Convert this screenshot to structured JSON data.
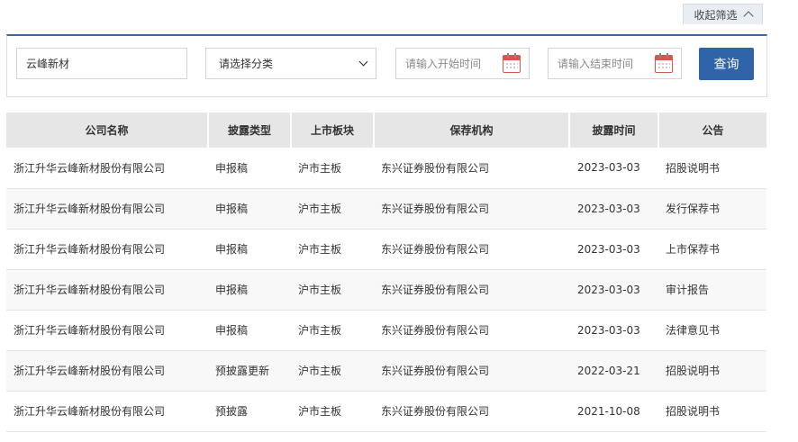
{
  "filter": {
    "collapse_label": "收起筛选",
    "company_value": "云峰新材",
    "category_placeholder": "请选择分类",
    "start_placeholder": "请输入开始时间",
    "end_placeholder": "请输入结束时间",
    "search_label": "查询"
  },
  "table": {
    "headers": [
      "公司名称",
      "披露类型",
      "上市板块",
      "保荐机构",
      "披露时间",
      "公告"
    ],
    "rows": [
      [
        "浙江升华云峰新材股份有限公司",
        "申报稿",
        "沪市主板",
        "东兴证券股份有限公司",
        "2023-03-03",
        "招股说明书"
      ],
      [
        "浙江升华云峰新材股份有限公司",
        "申报稿",
        "沪市主板",
        "东兴证券股份有限公司",
        "2023-03-03",
        "发行保荐书"
      ],
      [
        "浙江升华云峰新材股份有限公司",
        "申报稿",
        "沪市主板",
        "东兴证券股份有限公司",
        "2023-03-03",
        "上市保荐书"
      ],
      [
        "浙江升华云峰新材股份有限公司",
        "申报稿",
        "沪市主板",
        "东兴证券股份有限公司",
        "2023-03-03",
        "审计报告"
      ],
      [
        "浙江升华云峰新材股份有限公司",
        "申报稿",
        "沪市主板",
        "东兴证券股份有限公司",
        "2023-03-03",
        "法律意见书"
      ],
      [
        "浙江升华云峰新材股份有限公司",
        "预披露更新",
        "沪市主板",
        "东兴证券股份有限公司",
        "2022-03-21",
        "招股说明书"
      ],
      [
        "浙江升华云峰新材股份有限公司",
        "预披露",
        "沪市主板",
        "东兴证券股份有限公司",
        "2021-10-08",
        "招股说明书"
      ]
    ]
  },
  "icons": {
    "collapse": "chevron-up-icon",
    "category": "chevron-down-icon",
    "date": "calendar-icon"
  },
  "colors": {
    "accent": "#2f64a8",
    "header_bg": "#e6e6e6",
    "calendar_red": "#d9534f"
  }
}
